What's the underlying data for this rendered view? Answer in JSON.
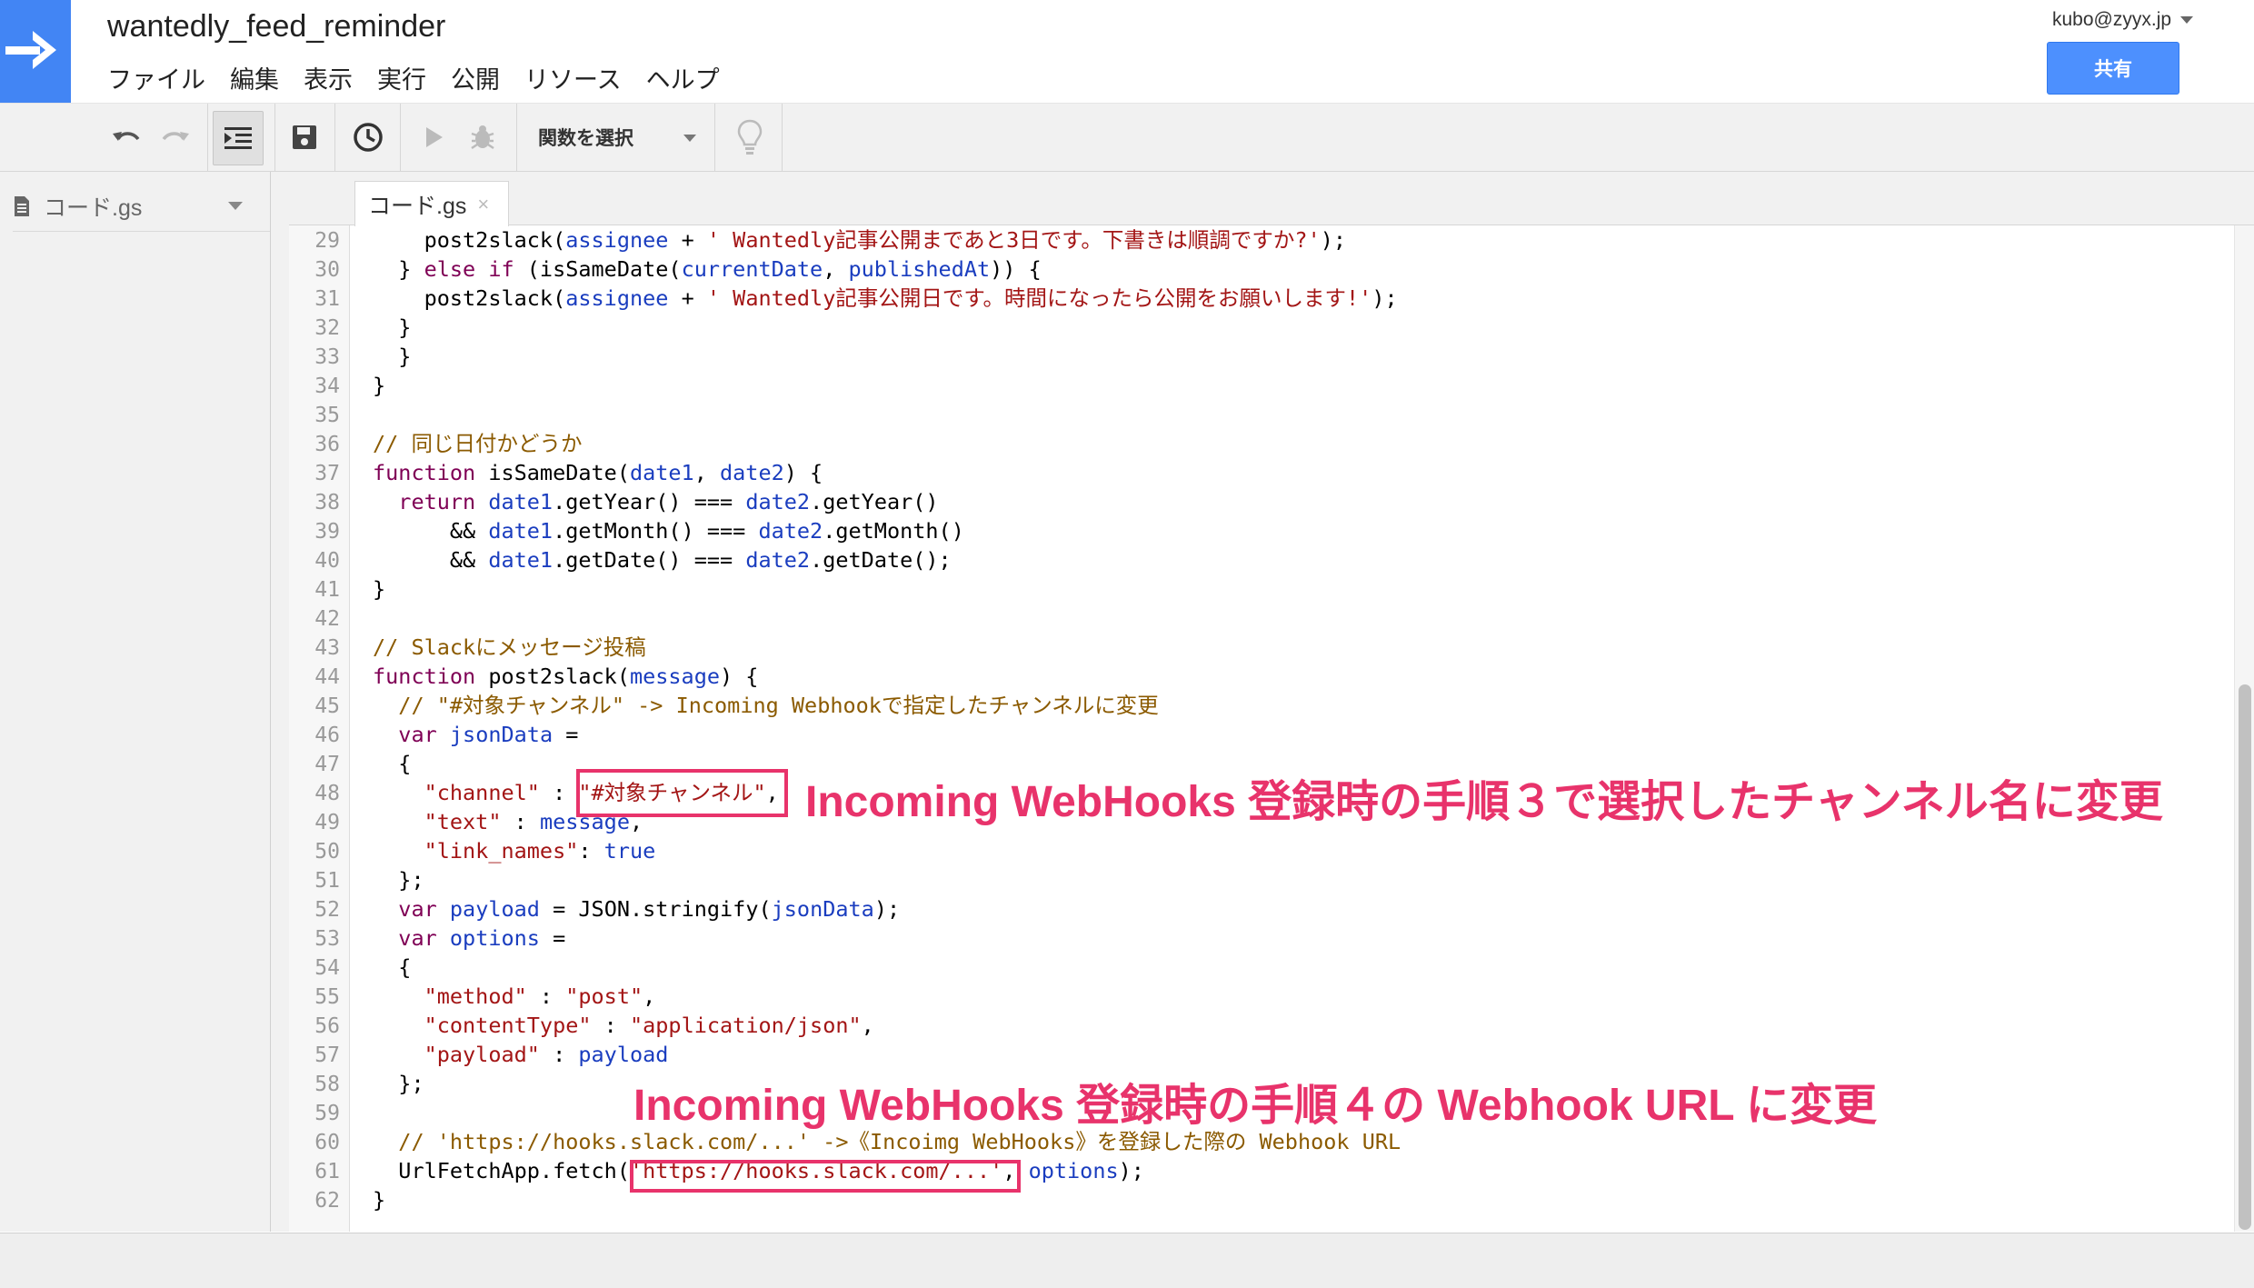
{
  "app": {
    "title": "wantedly_feed_reminder",
    "account": "kubo@zyyx.jp",
    "share_label": "共有"
  },
  "menu": [
    "ファイル",
    "編集",
    "表示",
    "実行",
    "公開",
    "リソース",
    "ヘルプ"
  ],
  "toolbar": {
    "function_select": "関数を選択"
  },
  "sidebar": {
    "file_name": "コード.gs"
  },
  "tab": {
    "label": "コード.gs",
    "close": "×"
  },
  "lines": [
    {
      "n": "29",
      "t": "    post2slack(assignee + ' Wantedly記事公開まであと3日です。下書きは順調ですか?');"
    },
    {
      "n": "30",
      "t": "  } else if (isSameDate(currentDate, publishedAt)) {"
    },
    {
      "n": "31",
      "t": "    post2slack(assignee + ' Wantedly記事公開日です。時間になったら公開をお願いします!');"
    },
    {
      "n": "32",
      "t": "  }"
    },
    {
      "n": "33",
      "t": "  }"
    },
    {
      "n": "34",
      "t": "}"
    },
    {
      "n": "35",
      "t": ""
    },
    {
      "n": "36",
      "t": "// 同じ日付かどうか"
    },
    {
      "n": "37",
      "t": "function isSameDate(date1, date2) {"
    },
    {
      "n": "38",
      "t": "  return date1.getYear() === date2.getYear()"
    },
    {
      "n": "39",
      "t": "      && date1.getMonth() === date2.getMonth()"
    },
    {
      "n": "40",
      "t": "      && date1.getDate() === date2.getDate();"
    },
    {
      "n": "41",
      "t": "}"
    },
    {
      "n": "42",
      "t": ""
    },
    {
      "n": "43",
      "t": "// Slackにメッセージ投稿"
    },
    {
      "n": "44",
      "t": "function post2slack(message) {"
    },
    {
      "n": "45",
      "t": "  // \"#対象チャンネル\" -> Incoming Webhookで指定したチャンネルに変更"
    },
    {
      "n": "46",
      "t": "  var jsonData ="
    },
    {
      "n": "47",
      "t": "  {"
    },
    {
      "n": "48",
      "t": "    \"channel\" : \"#対象チャンネル\","
    },
    {
      "n": "49",
      "t": "    \"text\" : message,"
    },
    {
      "n": "50",
      "t": "    \"link_names\": true"
    },
    {
      "n": "51",
      "t": "  };"
    },
    {
      "n": "52",
      "t": "  var payload = JSON.stringify(jsonData);"
    },
    {
      "n": "53",
      "t": "  var options ="
    },
    {
      "n": "54",
      "t": "  {"
    },
    {
      "n": "55",
      "t": "    \"method\" : \"post\","
    },
    {
      "n": "56",
      "t": "    \"contentType\" : \"application/json\","
    },
    {
      "n": "57",
      "t": "    \"payload\" : payload"
    },
    {
      "n": "58",
      "t": "  };"
    },
    {
      "n": "59",
      "t": ""
    },
    {
      "n": "60",
      "t": "  // 'https://hooks.slack.com/...' ->《Incoimg WebHooks》を登録した際の Webhook URL"
    },
    {
      "n": "61",
      "t": "  UrlFetchApp.fetch('https://hooks.slack.com/...', options);"
    },
    {
      "n": "62",
      "t": "}"
    }
  ],
  "annotations": {
    "channel_note": "Incoming WebHooks 登録時の手順３で選択したチャンネル名に変更",
    "url_note": "Incoming WebHooks 登録時の手順４の Webhook URL に変更"
  },
  "colors": {
    "accent": "#4285f4",
    "annotation": "#e8336b",
    "keyword": "#7f0055",
    "string": "#a31515",
    "comment": "#8b5a00",
    "variable": "#1a3dbf"
  }
}
